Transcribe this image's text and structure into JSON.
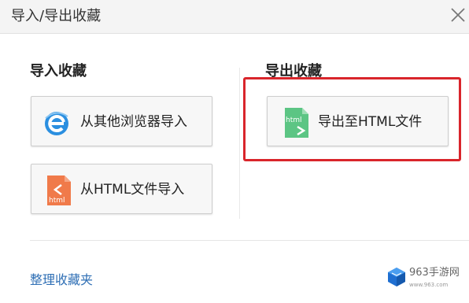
{
  "dialog": {
    "title": "导入/导出收藏"
  },
  "import_section": {
    "heading": "导入收藏",
    "from_browser_label": "从其他浏览器导入",
    "from_html_label": "从HTML文件导入"
  },
  "export_section": {
    "heading": "导出收藏",
    "to_html_label": "导出至HTML文件"
  },
  "footer": {
    "organize_link": "整理收藏夹"
  },
  "watermark": {
    "site_name": "963手游网",
    "site_url": "www.963.com"
  },
  "icons": {
    "html_badge_text": "html",
    "close": "close-icon",
    "browser": "ie-browser-icon",
    "html_file_import": "html-file-import-icon",
    "html_file_export": "html-file-export-icon"
  },
  "colors": {
    "highlight": "#d9252b",
    "link": "#2f6fb5",
    "export_icon": "#5cc584",
    "import_icon": "#f07a4a",
    "browser_icon": "#2b8fe0"
  }
}
